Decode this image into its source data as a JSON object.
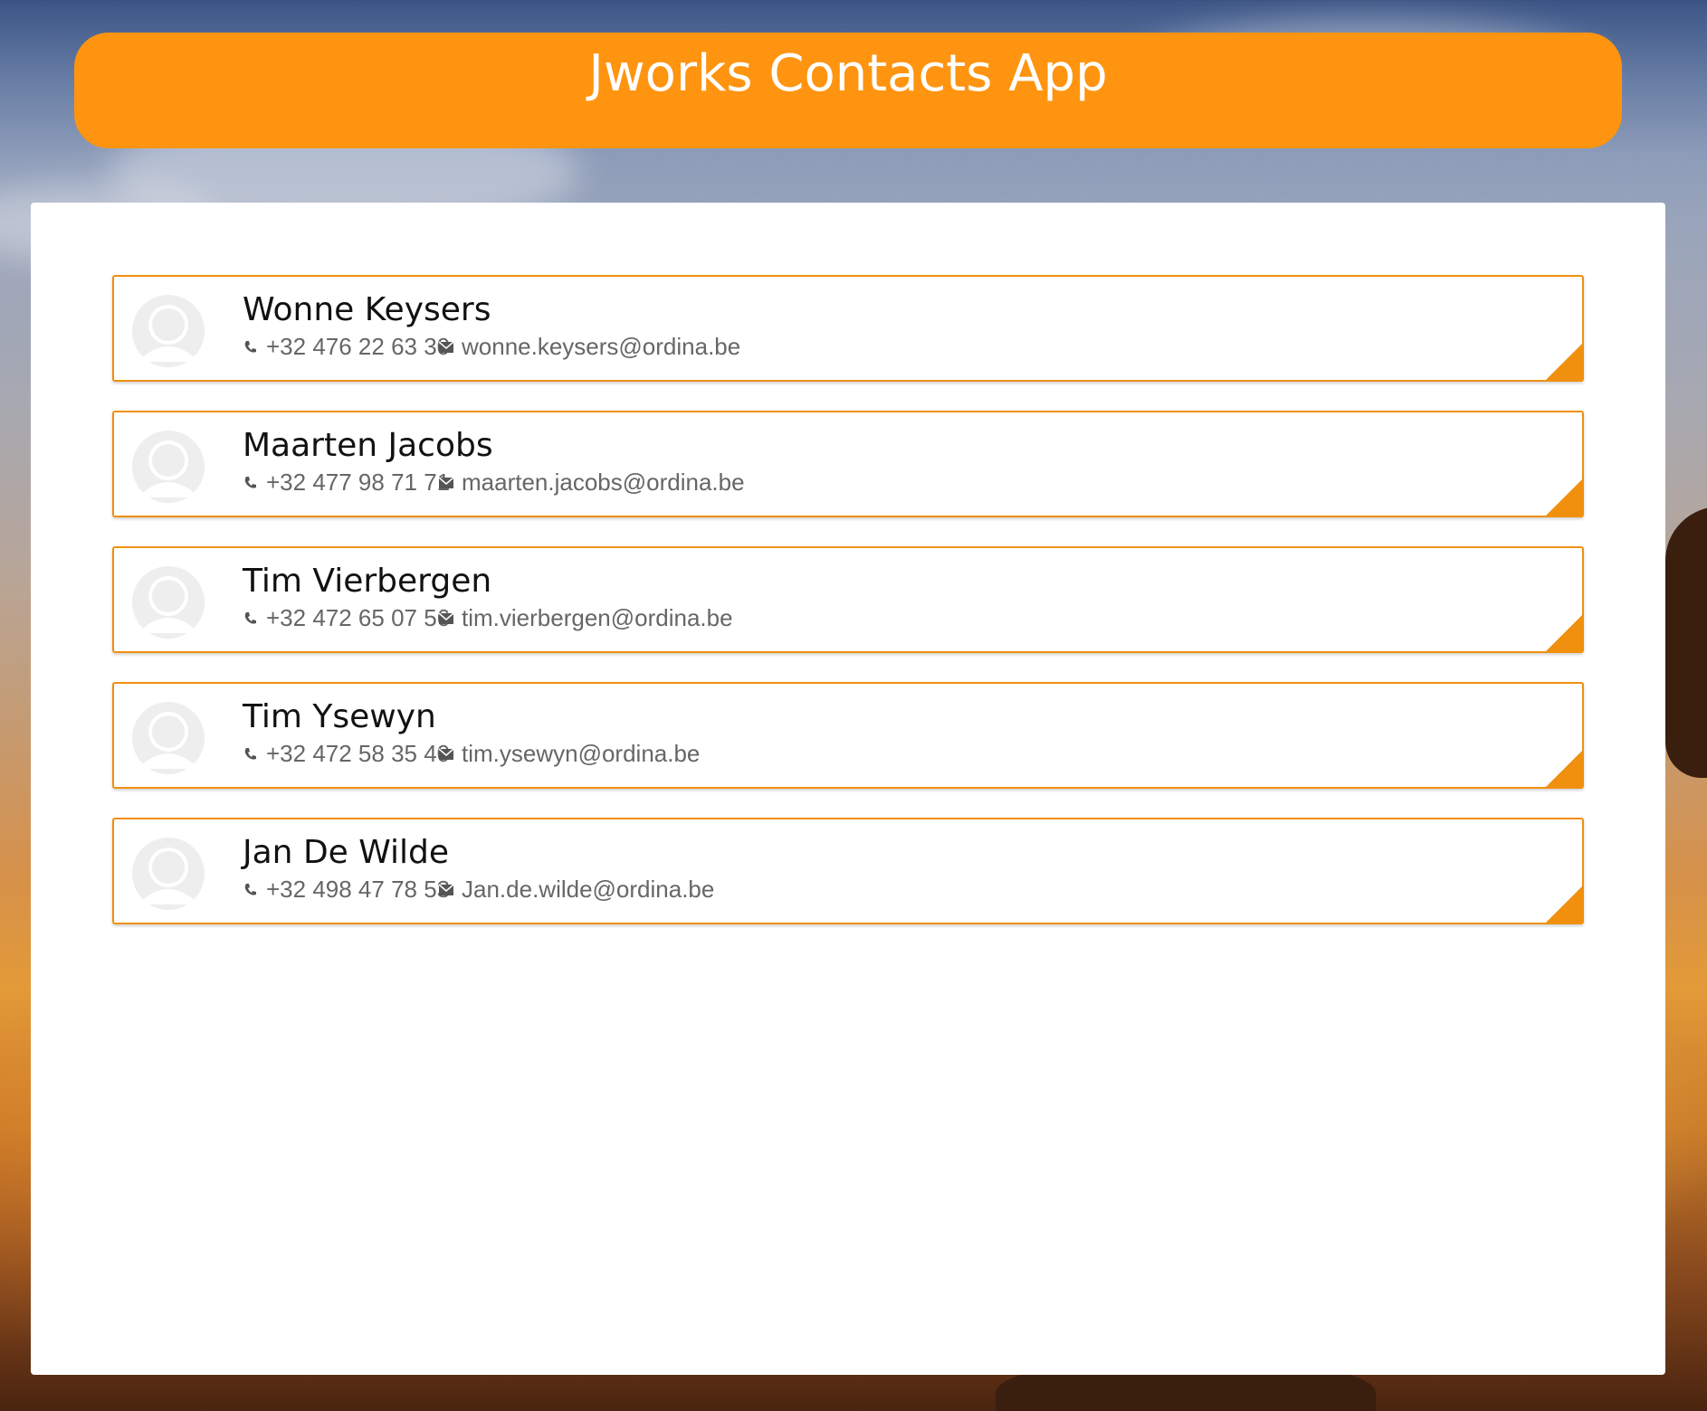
{
  "header": {
    "title": "Jworks Contacts App"
  },
  "colors": {
    "accent": "#ff9410",
    "card_border": "#f0900e",
    "panel": "#ffffff"
  },
  "contacts": [
    {
      "name": "Wonne Keysers",
      "phone": "+32 476 22 63 30",
      "email": "wonne.keysers@ordina.be",
      "avatar_icon": "user-placeholder-icon"
    },
    {
      "name": "Maarten Jacobs",
      "phone": "+32 477 98 71 71",
      "email": "maarten.jacobs@ordina.be",
      "avatar_icon": "user-placeholder-icon"
    },
    {
      "name": "Tim Vierbergen",
      "phone": "+32 472 65 07 56",
      "email": "tim.vierbergen@ordina.be",
      "avatar_icon": "user-placeholder-icon"
    },
    {
      "name": "Tim Ysewyn",
      "phone": "+32 472 58 35 40",
      "email": "tim.ysewyn@ordina.be",
      "avatar_icon": "user-placeholder-icon"
    },
    {
      "name": "Jan De Wilde",
      "phone": "+32 498 47 78 53",
      "email": "Jan.de.wilde@ordina.be",
      "avatar_icon": "user-placeholder-icon"
    }
  ]
}
